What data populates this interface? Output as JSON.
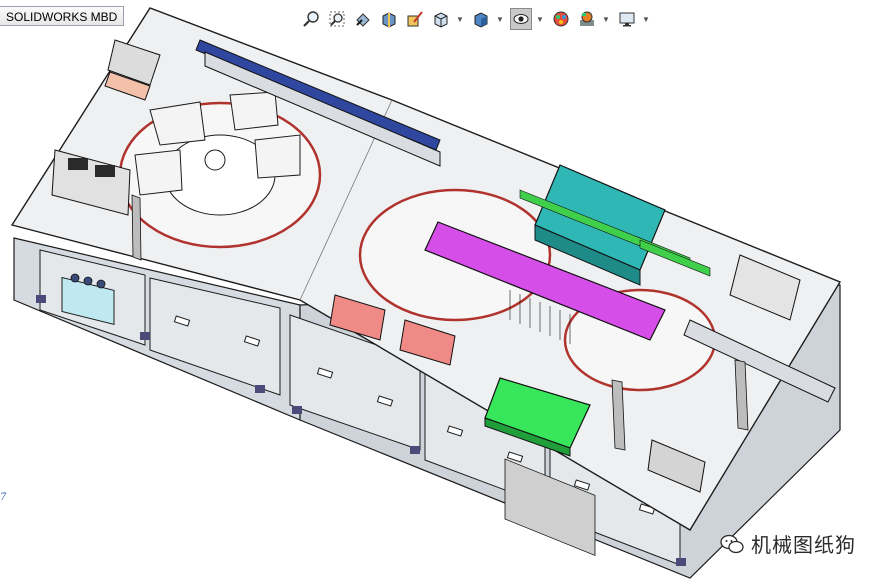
{
  "window": {
    "tab_title": "SOLIDWORKS MBD"
  },
  "toolbar": {
    "buttons": [
      {
        "icon": "zoom-to-fit-icon"
      },
      {
        "icon": "zoom-to-area-icon"
      },
      {
        "icon": "previous-view-icon"
      },
      {
        "icon": "section-view-icon"
      },
      {
        "icon": "dynamic-annotation-views-icon"
      },
      {
        "icon": "view-orientation-icon"
      },
      {
        "icon": "display-style-icon"
      },
      {
        "icon": "hide-show-items-icon"
      },
      {
        "icon": "edit-appearance-icon"
      },
      {
        "icon": "apply-scene-icon"
      },
      {
        "icon": "view-settings-icon"
      }
    ]
  },
  "viewport": {
    "triad_label": "7",
    "colors": {
      "frame": "#ececec",
      "leg_panel": "#cfd6dc",
      "outline": "#1c1c1c",
      "teal_cover": "#2fb7b5",
      "magenta_plate": "#d64ee8",
      "green_plate": "#37e65a",
      "salmon_block": "#f08a86",
      "red_ring": "#b0332e",
      "blue_rail": "#3047a0"
    }
  },
  "watermark": {
    "text": "机械图纸狗"
  }
}
